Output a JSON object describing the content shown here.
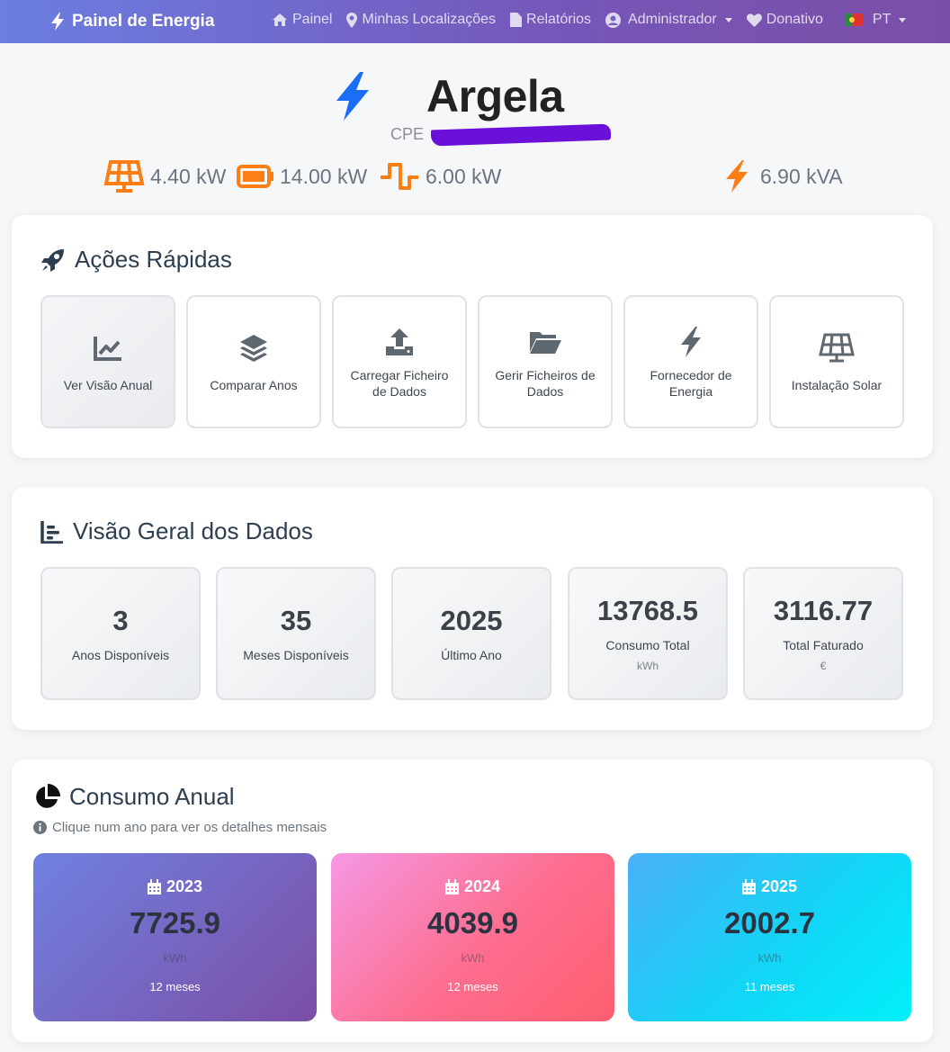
{
  "nav": {
    "brand": "Painel de Energia",
    "items": [
      {
        "label": "Painel",
        "icon": "home-icon"
      },
      {
        "label": "Minhas Localizações",
        "icon": "map-marker-icon"
      },
      {
        "label": "Relatórios",
        "icon": "file-pdf-icon"
      },
      {
        "label": "Administrador",
        "icon": "user-circle-icon"
      },
      {
        "label": "Donativo",
        "icon": "heart-icon"
      }
    ],
    "language": "PT"
  },
  "site": {
    "name": "Argela",
    "cpe_label": "CPE"
  },
  "specs": {
    "solar": "4.40 kW",
    "battery": "14.00 kW",
    "inverter": "6.00 kW",
    "contracted": "6.90 kVA"
  },
  "quick_actions": {
    "title": "Ações Rápidas",
    "items": [
      {
        "label": "Ver Visão Anual",
        "icon": "chart-line-icon"
      },
      {
        "label": "Comparar Anos",
        "icon": "layers-icon"
      },
      {
        "label": "Carregar Ficheiro de Dados",
        "icon": "upload-icon"
      },
      {
        "label": "Gerir Ficheiros de Dados",
        "icon": "folder-open-icon"
      },
      {
        "label": "Fornecedor de Energia",
        "icon": "bolt-icon"
      },
      {
        "label": "Instalação Solar",
        "icon": "solar-panel-icon"
      }
    ]
  },
  "overview": {
    "title": "Visão Geral dos Dados",
    "stats": [
      {
        "value": "3",
        "label": "Anos Disponíveis",
        "unit": ""
      },
      {
        "value": "35",
        "label": "Meses Disponíveis",
        "unit": ""
      },
      {
        "value": "2025",
        "label": "Último Ano",
        "unit": ""
      },
      {
        "value": "13768.5",
        "label": "Consumo Total",
        "unit": "kWh"
      },
      {
        "value": "3116.77",
        "label": "Total Faturado",
        "unit": "€"
      }
    ]
  },
  "annual": {
    "title": "Consumo Anual",
    "hint": "Clique num ano para ver os detalhes mensais",
    "years": [
      {
        "year": "2023",
        "value": "7725.9",
        "unit": "kWh",
        "months": "12 meses"
      },
      {
        "year": "2024",
        "value": "4039.9",
        "unit": "kWh",
        "months": "12 meses"
      },
      {
        "year": "2025",
        "value": "2002.7",
        "unit": "kWh",
        "months": "11 meses"
      }
    ]
  },
  "colors": {
    "accent_orange": "#fd7e14",
    "accent_blue": "#1a6ef5",
    "tile_2023": "#6f7fdc",
    "tile_2024": "#f780b8",
    "tile_2025": "#22c3f3"
  }
}
